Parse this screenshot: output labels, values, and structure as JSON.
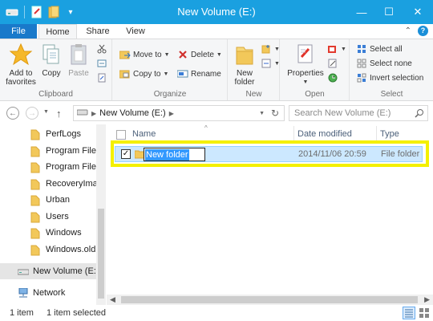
{
  "window": {
    "title": "New Volume (E:)",
    "controls": {
      "minimize": "—",
      "maximize": "☐",
      "close": "✕"
    }
  },
  "tabs": {
    "file": "File",
    "home": "Home",
    "share": "Share",
    "view": "View",
    "help": "?"
  },
  "ribbon": {
    "clipboard": {
      "label": "Clipboard",
      "add_to_favorites": "Add to favorites",
      "copy": "Copy",
      "paste": "Paste"
    },
    "organize": {
      "label": "Organize",
      "move_to": "Move to",
      "copy_to": "Copy to",
      "delete": "Delete",
      "rename": "Rename"
    },
    "new": {
      "label": "New",
      "new_folder": "New folder"
    },
    "open": {
      "label": "Open",
      "properties": "Properties"
    },
    "select": {
      "label": "Select",
      "select_all": "Select all",
      "select_none": "Select none",
      "invert_selection": "Invert selection"
    }
  },
  "address": {
    "path": "New Volume (E:)",
    "search_placeholder": "Search New Volume (E:)"
  },
  "nav": {
    "folders": [
      "PerfLogs",
      "Program Files",
      "Program Files",
      "RecoveryImag",
      "Urban",
      "Users",
      "Windows",
      "Windows.old"
    ],
    "drive": "New Volume (E:)",
    "network": "Network"
  },
  "columns": {
    "name": "Name",
    "date_modified": "Date modified",
    "type": "Type"
  },
  "files": [
    {
      "name": "New folder",
      "date_modified": "2014/11/06 20:59",
      "type": "File folder",
      "checked": true,
      "renaming": true
    }
  ],
  "status": {
    "count": "1 item",
    "selected": "1 item selected"
  },
  "colors": {
    "titlebar": "#1aa0e0",
    "file_tab": "#1979ca",
    "selection_row": "#cce8ff",
    "highlight_box": "#f4f000",
    "folder": "#f2c85a"
  }
}
